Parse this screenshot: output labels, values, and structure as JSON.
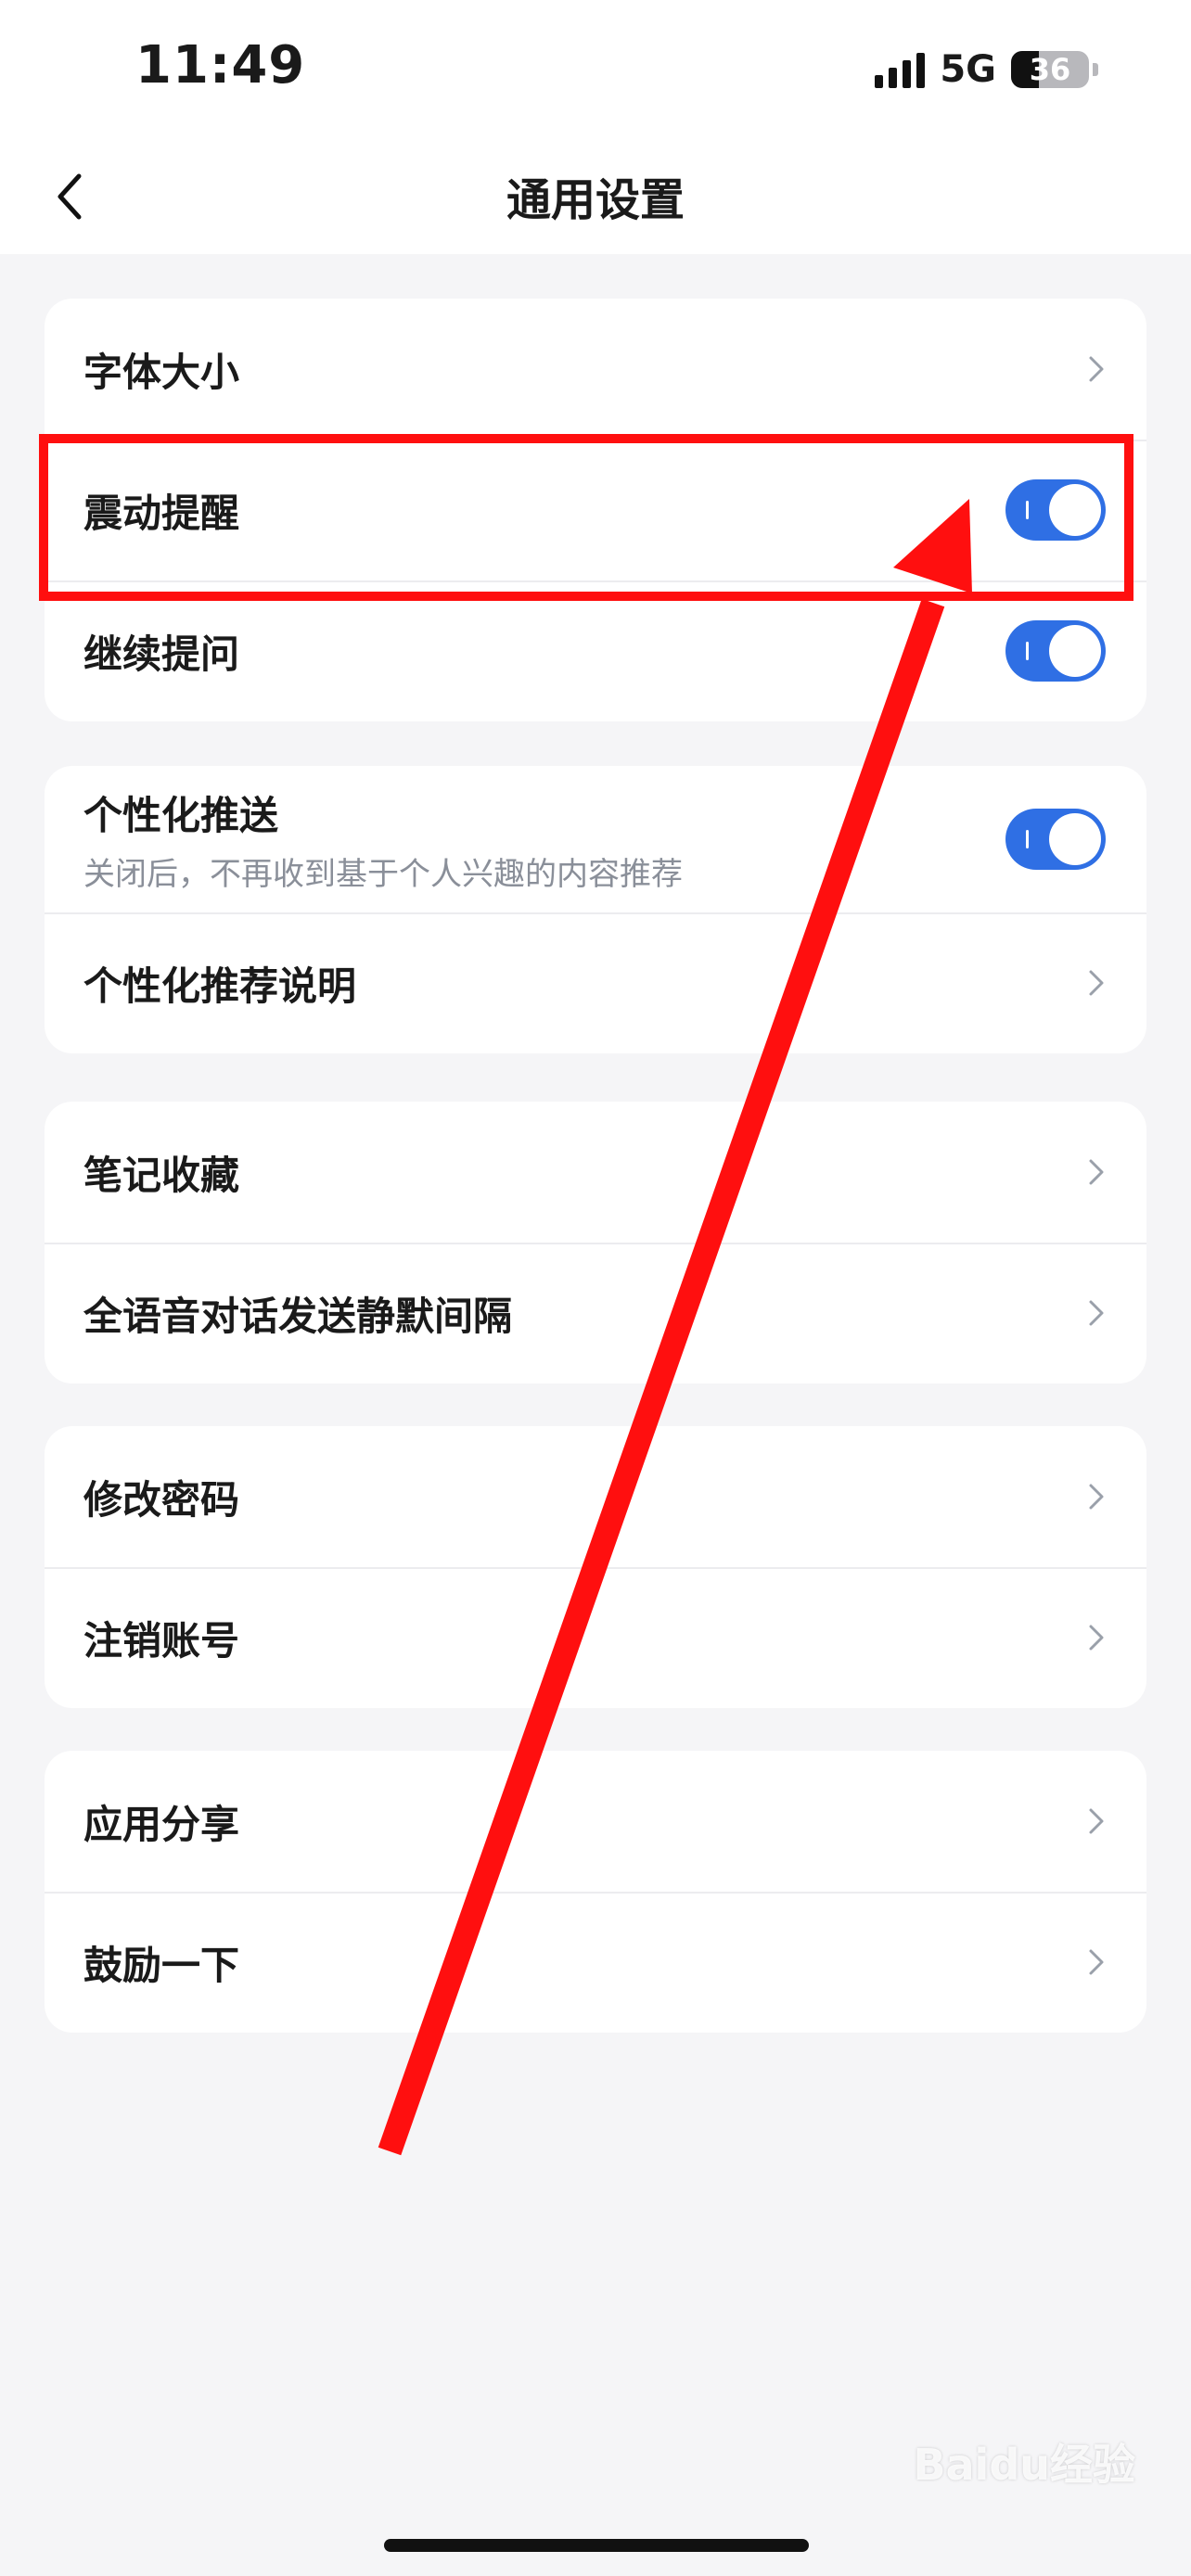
{
  "status_bar": {
    "time": "11:49",
    "network": "5G",
    "battery_level": "36",
    "battery_fraction": 0.36
  },
  "header": {
    "title": "通用设置",
    "back_icon": "chevron-left-icon"
  },
  "groups": [
    {
      "rows": [
        {
          "label": "字体大小",
          "control": "chevron"
        },
        {
          "label": "震动提醒",
          "control": "toggle",
          "on": true
        },
        {
          "label": "继续提问",
          "control": "toggle",
          "on": true
        }
      ]
    },
    {
      "rows": [
        {
          "label": "个性化推送",
          "sublabel": "关闭后，不再收到基于个人兴趣的内容推荐",
          "control": "toggle",
          "on": true
        },
        {
          "label": "个性化推荐说明",
          "control": "chevron"
        }
      ]
    },
    {
      "rows": [
        {
          "label": "笔记收藏",
          "control": "chevron"
        },
        {
          "label": "全语音对话发送静默间隔",
          "control": "chevron"
        }
      ]
    },
    {
      "rows": [
        {
          "label": "修改密码",
          "control": "chevron"
        },
        {
          "label": "注销账号",
          "control": "chevron"
        }
      ]
    },
    {
      "rows": [
        {
          "label": "应用分享",
          "control": "chevron"
        },
        {
          "label": "鼓励一下",
          "control": "chevron"
        }
      ]
    }
  ],
  "watermark": "Baidu经验",
  "colors": {
    "accent": "#2f6fe4",
    "annotation": "#ff0f0f",
    "background": "#f5f5f7"
  }
}
